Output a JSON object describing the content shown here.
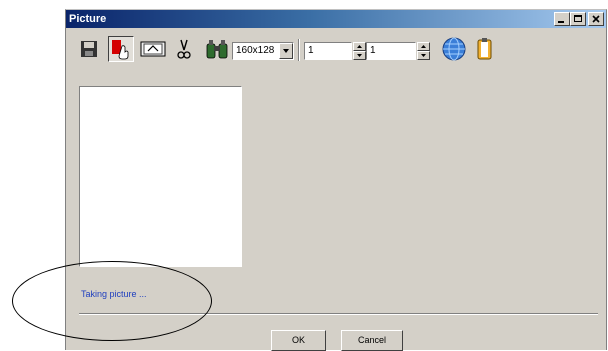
{
  "window": {
    "title": "Picture"
  },
  "toolbar": {
    "resolution_value": "160x128",
    "spin1_value": "1",
    "spin2_value": "1"
  },
  "status_text": "Taking picture ...",
  "buttons": {
    "ok_label": "OK",
    "cancel_label": "Cancel"
  },
  "icons": [
    "save-icon",
    "capture-icon",
    "camera-icon",
    "cut-icon",
    "binoculars-icon",
    "globe-icon",
    "clipboard-icon"
  ]
}
